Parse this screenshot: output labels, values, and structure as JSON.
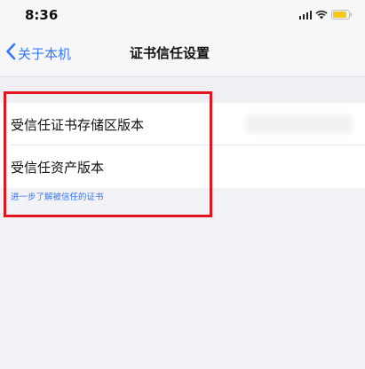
{
  "status_bar": {
    "time": "8:36",
    "icons": [
      "signal-icon",
      "wifi-icon",
      "battery-icon"
    ],
    "battery_color": "#f5c518"
  },
  "nav": {
    "back_label": "关于本机",
    "title": "证书信任设置",
    "accent_color": "#3478f6"
  },
  "settings": {
    "rows": [
      {
        "label": "受信任证书存储区版本"
      },
      {
        "label": "受信任资产版本"
      }
    ],
    "footer_link": "进一步了解被信任的证书"
  },
  "annotation": {
    "highlight_color": "#e3141f"
  }
}
